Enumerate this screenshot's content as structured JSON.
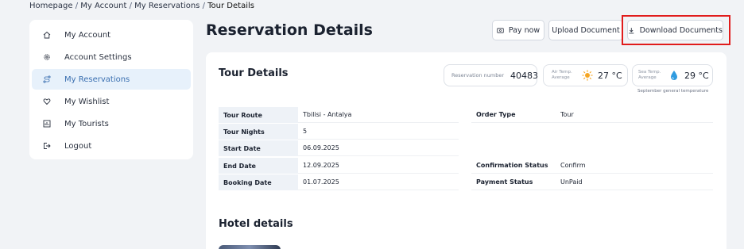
{
  "breadcrumb": {
    "items": [
      "Homepage",
      "My Account",
      "My Reservations"
    ],
    "current": "Tour Details",
    "separator": "/"
  },
  "sidebar": {
    "items": [
      {
        "label": "My Account",
        "icon": "home-icon",
        "active": false
      },
      {
        "label": "Account Settings",
        "icon": "gear-icon",
        "active": false
      },
      {
        "label": "My Reservations",
        "icon": "route-icon",
        "active": true
      },
      {
        "label": "My Wishlist",
        "icon": "heart-icon",
        "active": false
      },
      {
        "label": "My Tourists",
        "icon": "users-icon",
        "active": false
      },
      {
        "label": "Logout",
        "icon": "logout-icon",
        "active": false
      }
    ]
  },
  "header": {
    "title": "Reservation Details",
    "pay_label": "Pay now",
    "upload_label": "Upload Document",
    "download_label": "Download Documents"
  },
  "tour": {
    "title": "Tour Details",
    "reservation_label": "Reservation number",
    "reservation_number": "40483",
    "air_label": "Air Temp.",
    "air_sub": "Average",
    "air_temp": "27 °C",
    "sea_label": "Sea Temp.",
    "sea_sub": "Average",
    "sea_temp": "29 °C",
    "season_note": "September general temperature",
    "left_rows": [
      {
        "label": "Tour Route",
        "value": "Tbilisi - Antalya"
      },
      {
        "label": "Tour Nights",
        "value": "5"
      },
      {
        "label": "Start Date",
        "value": "06.09.2025"
      },
      {
        "label": "End Date",
        "value": "12.09.2025"
      },
      {
        "label": "Booking Date",
        "value": "01.07.2025"
      }
    ],
    "right_rows": [
      {
        "label": "Order Type",
        "value": "Tour"
      },
      {
        "label": "Confirmation Status",
        "value": "Confirm"
      },
      {
        "label": "Payment Status",
        "value": "UnPaid"
      }
    ]
  },
  "hotel": {
    "title": "Hotel details"
  },
  "colors": {
    "accent": "#3a6fb0",
    "active_bg": "#e7f1fb",
    "highlight": "#e11c1c",
    "sun": "#f5a623",
    "drop": "#2f9be0"
  }
}
